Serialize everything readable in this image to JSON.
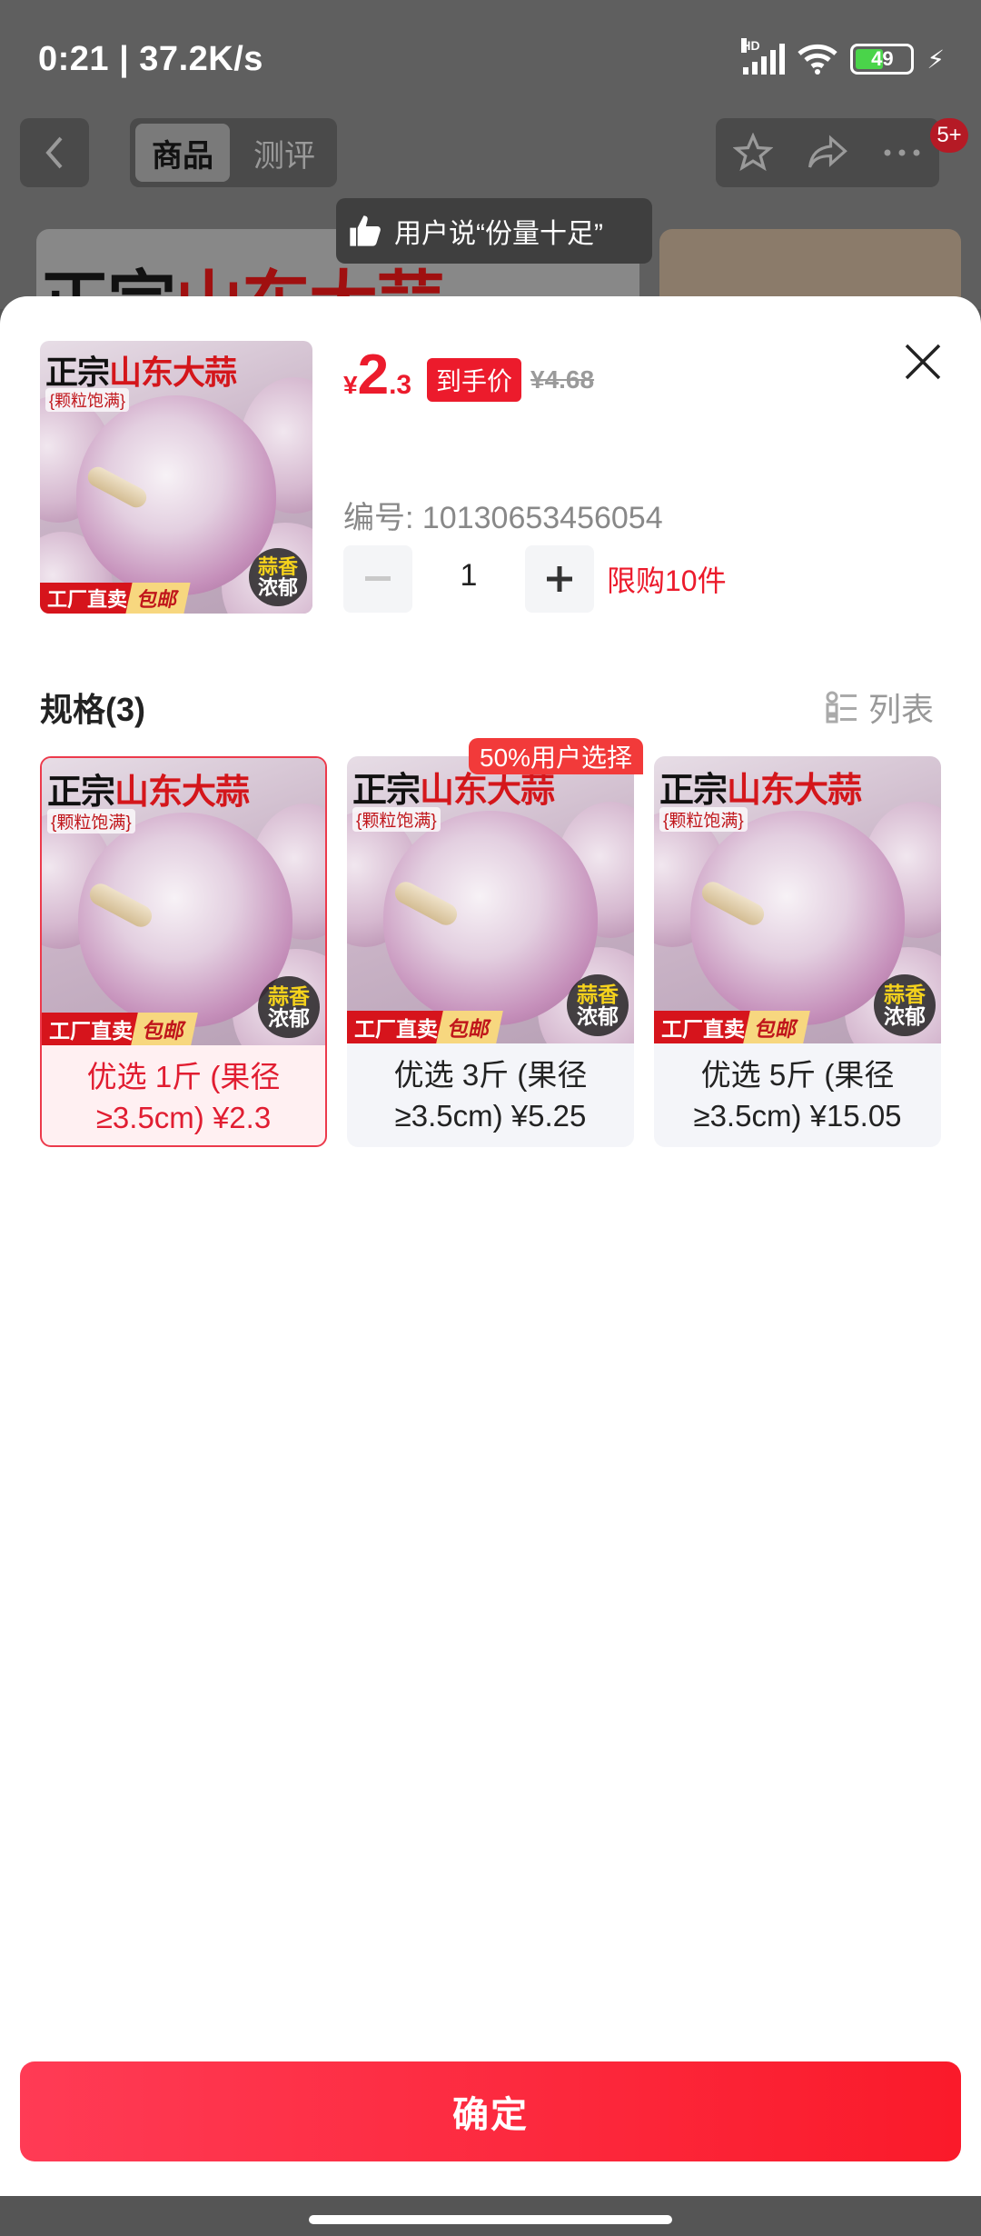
{
  "status_bar": {
    "time_speed": "0:21 | 37.2K/s",
    "battery": "49"
  },
  "nav": {
    "tabs": [
      "商品",
      "测评"
    ],
    "badge": "5+"
  },
  "background": {
    "banner_title_a": "正宗",
    "banner_title_b": "山东大蒜",
    "toast": "用户说“份量十足”"
  },
  "product": {
    "image": {
      "title_a": "正宗",
      "title_b": "山东大蒜",
      "subtitle": "{颗粒饱满}",
      "ribbon_a": "工厂直卖",
      "ribbon_b": "包邮",
      "circle_a": "蒜香",
      "circle_b": "浓郁"
    },
    "price_currency": "¥",
    "price_int": "2",
    "price_dec": ".3",
    "price_tag": "到手价",
    "original_price": "¥4.68",
    "sku_number": "编号: 10130653456054",
    "quantity": "1",
    "limit": "限购10件"
  },
  "specs": {
    "title": "规格(3)",
    "view_toggle": "列表",
    "badge": "50%用户选择",
    "options": [
      {
        "label": "优选 1斤 (果径≥3.5cm) ¥2.3",
        "selected": true
      },
      {
        "label": "优选 3斤 (果径≥3.5cm) ¥5.25",
        "selected": false
      },
      {
        "label": "优选 5斤 (果径≥3.5cm) ¥15.05",
        "selected": false
      }
    ]
  },
  "confirm_label": "确定",
  "colors": {
    "accent": "#ec1b2c",
    "selected_bg": "#fff0f2"
  }
}
